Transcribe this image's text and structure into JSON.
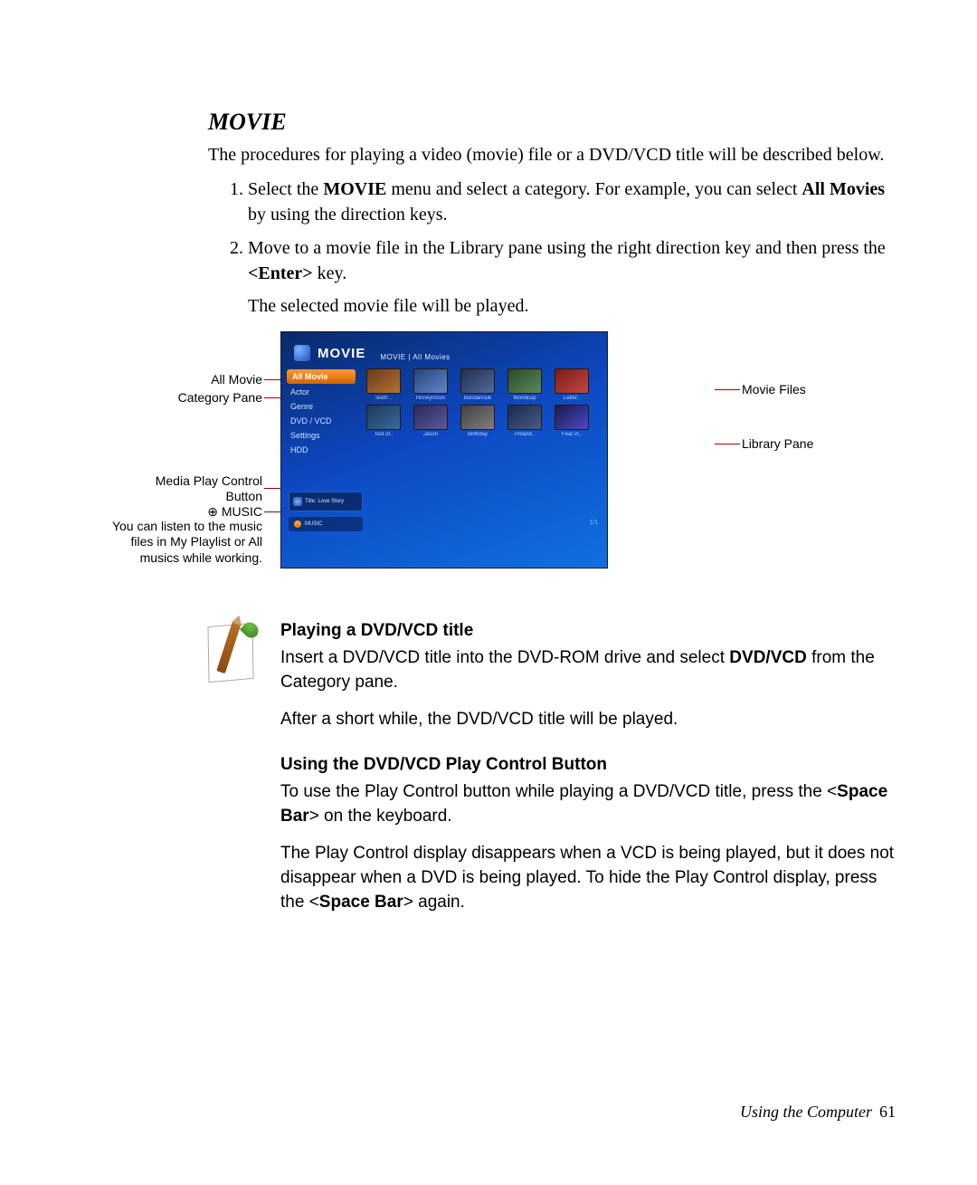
{
  "title": "MOVIE",
  "intro": "The procedures for playing a video (movie) file or a DVD/VCD title will be described below.",
  "steps": {
    "s1_pre": "Select the ",
    "s1_b1": "MOVIE",
    "s1_mid": " menu and select a category. For example, you can select ",
    "s1_b2": "All Movies",
    "s1_post": " by using the direction keys.",
    "s2_pre": "Move to a movie file in the Library pane using the right direction key and then press the ",
    "s2_b1": "<Enter>",
    "s2_post": " key.",
    "s2_extra": "The selected movie file will be played."
  },
  "figure": {
    "left_labels": {
      "all_movie": "All Movie",
      "category_pane": "Category Pane",
      "media_control": "Media Play Control Button",
      "music_title": "⊕ MUSIC",
      "music_desc": "You can listen to the music files in My Playlist or All musics while working."
    },
    "right_labels": {
      "movie_files": "Movie Files",
      "library_pane": "Library Pane"
    },
    "screenshot": {
      "title": "MOVIE",
      "crumb": "MOVIE   |  All Movies",
      "sidebar": [
        "All Movie",
        "Actor",
        "Genre",
        "DVD / VCD",
        "Settings",
        "HDD"
      ],
      "thumbs": [
        "Teeth ..",
        "Honeymoon",
        "Bundanouk",
        "Worldcup",
        "Letter..",
        "Test of..",
        "Jason",
        "Birthday",
        "Poland..",
        "Fear in.."
      ],
      "control_label": "Title: Love Story",
      "music_label": "MUSIC",
      "pagenum": "1/1"
    }
  },
  "sections": {
    "s1_title": "Playing a DVD/VCD title",
    "s1_p1a": "Insert a DVD/VCD title into the DVD-ROM drive and select ",
    "s1_p1b": "DVD/VCD",
    "s1_p1c": " from the Category pane.",
    "s1_p2": "After a short while, the DVD/VCD title will be played.",
    "s2_title": "Using the DVD/VCD Play Control Button",
    "s2_p1a": "To use the Play Control button while playing a DVD/VCD title, press the <",
    "s2_p1b": "Space Bar",
    "s2_p1c": "> on the keyboard.",
    "s2_p2a": "The Play Control display disappears when a VCD is being played, but it does not disappear when a DVD is being played. To hide the Play Control display, press the <",
    "s2_p2b": "Space Bar",
    "s2_p2c": "> again."
  },
  "footer": {
    "text": "Using the Computer",
    "page": "61"
  }
}
